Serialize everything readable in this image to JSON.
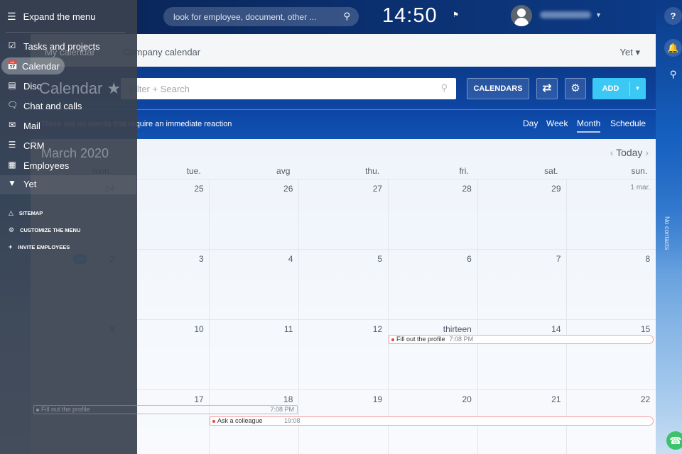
{
  "topbar": {
    "search_placeholder": "look for employee, document, other ...",
    "clock": "14:50"
  },
  "rightbar": {
    "no_contacts": "No contacts"
  },
  "tabs": {
    "my": "My calendar",
    "company": "Company calendar",
    "more": "Yet ▾"
  },
  "toolbar": {
    "title": "Calendar",
    "filter_placeholder": "Filter + Search",
    "calendars": "CALENDARS",
    "add": "ADD"
  },
  "notice": "There are no events that require an immediate reaction",
  "views": [
    "Day",
    "Week",
    "Month",
    "Schedule"
  ],
  "calendar": {
    "month": "March 2020",
    "today": "Today",
    "weekdays": [
      "mon.",
      "tue.",
      "avg",
      "thu.",
      "fri.",
      "sat.",
      "sun."
    ],
    "weeks": [
      [
        "24",
        "25",
        "26",
        "27",
        "28",
        "29",
        "1 mar."
      ],
      [
        "2",
        "3",
        "4",
        "5",
        "6",
        "7",
        "8"
      ],
      [
        "9",
        "10",
        "11",
        "12",
        "thirteen",
        "14",
        "15"
      ],
      [
        "16",
        "17",
        "18",
        "19",
        "20",
        "21",
        "22"
      ]
    ],
    "events": [
      {
        "title": "Fill out the profile",
        "time": "7:08 PM"
      },
      {
        "title": "Fill out the profile",
        "time": "7:08 PM"
      },
      {
        "title": "Ask a colleague",
        "time": "19:08"
      }
    ]
  },
  "menu": {
    "expand": "Expand the menu",
    "items": [
      "Tasks and projects",
      "Calendar",
      "Disc",
      "Chat and calls",
      "Mail",
      "CRM",
      "Employees",
      "Yet"
    ],
    "links": [
      "SITEMAP",
      "CUSTOMIZE THE MENU",
      "INVITE EMPLOYEES"
    ]
  },
  "colors": {
    "accent": "#3bc8f5",
    "event_border": "#f5a5a5",
    "menu_bg": "#3a4250"
  }
}
